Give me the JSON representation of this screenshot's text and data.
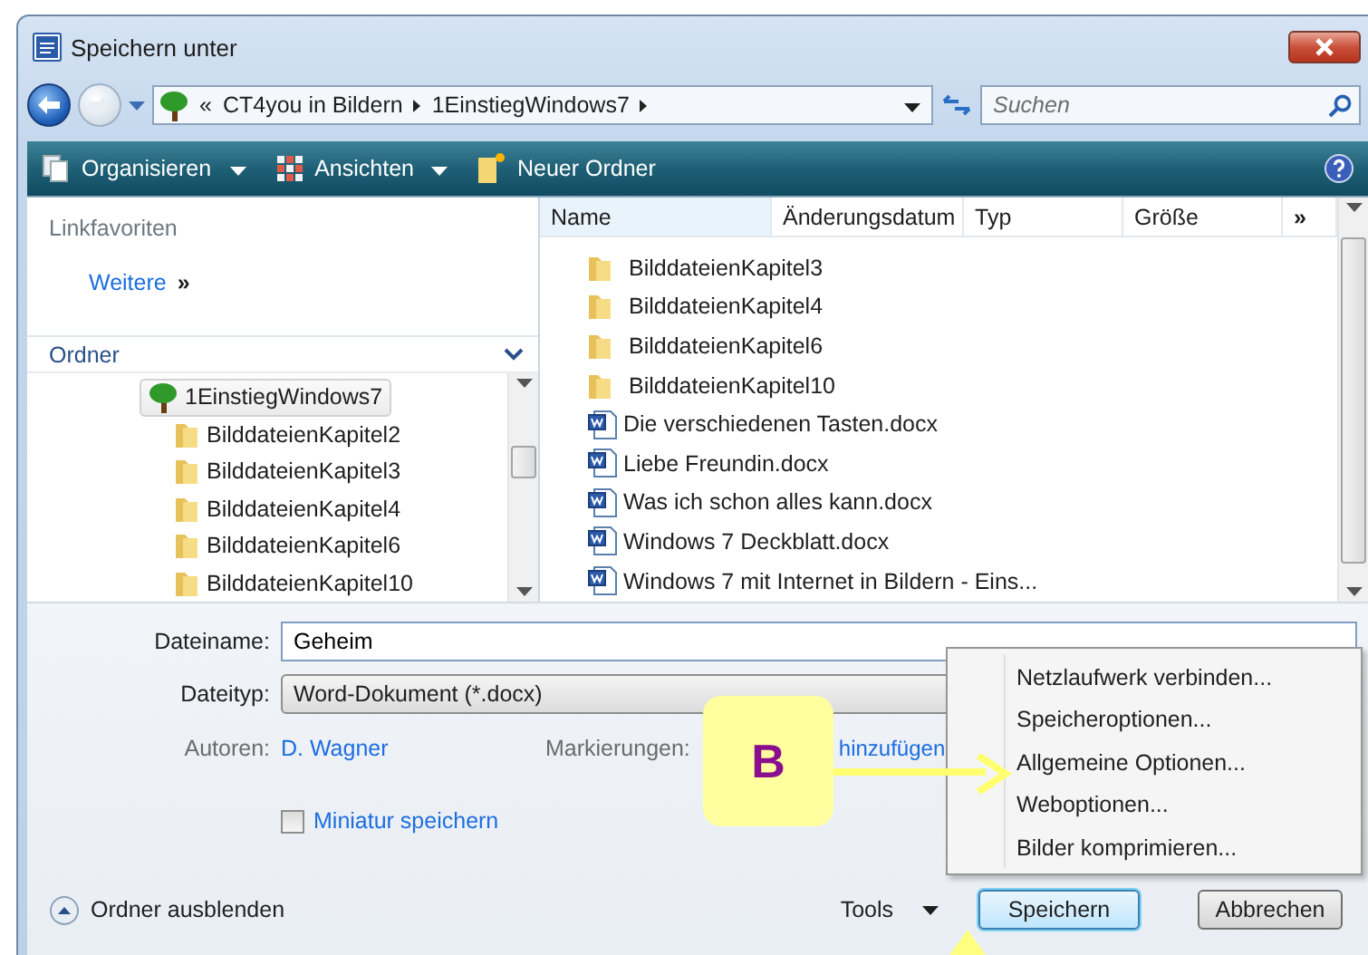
{
  "window": {
    "title": "Speichern unter"
  },
  "address": {
    "breadcrumbs": [
      "CT4you in Bildern",
      "1EinstiegWindows7"
    ],
    "overflow": "«"
  },
  "search": {
    "placeholder": "Suchen"
  },
  "toolbar": [
    {
      "label": "Organisieren",
      "kind": "organize",
      "dropdown": true
    },
    {
      "label": "Ansichten",
      "kind": "views",
      "dropdown": true
    },
    {
      "label": "Neuer Ordner",
      "kind": "new-folder",
      "dropdown": false
    }
  ],
  "nav": {
    "favorites_title": "Linkfavoriten",
    "more_link": "Weitere",
    "more_glyph": "»",
    "folders_title": "Ordner",
    "tree": [
      {
        "label": "1EinstiegWindows7",
        "selected": true,
        "children": [
          {
            "label": "BilddateienKapitel2",
            "selected": false
          },
          {
            "label": "BilddateienKapitel3",
            "selected": false
          },
          {
            "label": "BilddateienKapitel4",
            "selected": false
          },
          {
            "label": "BilddateienKapitel6",
            "selected": false
          },
          {
            "label": "BilddateienKapitel10",
            "selected": false
          }
        ]
      }
    ]
  },
  "table": {
    "columns": [
      "Name",
      "Änderungsdatum",
      "Typ",
      "Größe"
    ],
    "more": "»",
    "rows": [
      {
        "name": "BilddateienKapitel3",
        "kind": "folder"
      },
      {
        "name": "BilddateienKapitel4",
        "kind": "folder"
      },
      {
        "name": "BilddateienKapitel6",
        "kind": "folder"
      },
      {
        "name": "BilddateienKapitel10",
        "kind": "folder"
      },
      {
        "name": "Die verschiedenen Tasten.docx",
        "kind": "document"
      },
      {
        "name": "Liebe Freundin.docx",
        "kind": "document"
      },
      {
        "name": "Was ich schon alles kann.docx",
        "kind": "document"
      },
      {
        "name": "Windows 7 Deckblatt.docx",
        "kind": "document"
      },
      {
        "name": "Windows 7 mit Internet in Bildern - Eins...",
        "kind": "document"
      }
    ]
  },
  "form": {
    "filename": {
      "label": "Dateiname:",
      "value": "Geheim"
    },
    "filetype": {
      "label": "Dateityp:",
      "value": "Word-Dokument (*.docx)"
    },
    "authors": {
      "label": "Autoren:",
      "value": "D. Wagner"
    },
    "tags": {
      "label": "Markierungen:",
      "value": "hinzufügen"
    },
    "thumbnail": {
      "label": "Miniatur speichern",
      "checked": false
    }
  },
  "hide_folders": "Ordner ausblenden",
  "tools": "Tools",
  "buttons": [
    {
      "label": "Speichern",
      "default": true
    },
    {
      "label": "Abbrechen",
      "default": false
    }
  ],
  "tools_menu": [
    "Netzlaufwerk verbinden...",
    "Speicheroptionen...",
    "Allgemeine Optionen...",
    "Weboptionen...",
    "Bilder komprimieren..."
  ],
  "callout": {
    "label": "B"
  }
}
